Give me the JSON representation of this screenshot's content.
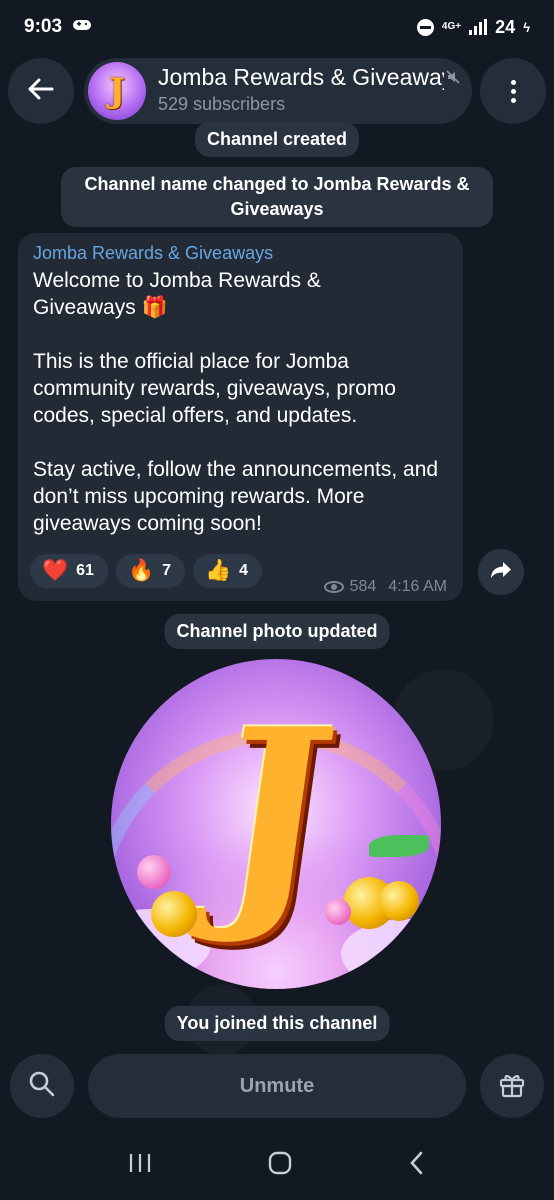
{
  "status": {
    "time": "9:03",
    "network": "4G+",
    "battery": "24"
  },
  "header": {
    "channel_title": "Jomba Rewards & Giveaways",
    "subscribers": "529 subscribers",
    "avatar_letter": "J"
  },
  "service_messages": {
    "created": "Channel created",
    "renamed": "Channel name changed to Jomba Rewards & Giveaways",
    "photo_updated": "Channel photo updated",
    "joined": "You joined this channel"
  },
  "post": {
    "author": "Jomba Rewards & Giveaways",
    "text": "Welcome to Jomba Rewards &\nGiveaways 🎁\n\nThis is the official place for Jomba community rewards, giveaways, promo codes, special offers, and updates.\n\nStay active, follow the announcements, and don’t miss upcoming rewards. More giveaways coming soon!",
    "reactions": [
      {
        "emoji": "❤️",
        "count": "61"
      },
      {
        "emoji": "🔥",
        "count": "7"
      },
      {
        "emoji": "👍",
        "count": "4"
      }
    ],
    "views": "584",
    "time": "4:16 AM"
  },
  "channel_photo": {
    "letter": "J"
  },
  "bottom": {
    "unmute_label": "Unmute"
  },
  "icons": {
    "back": "back-arrow-icon",
    "menu": "more-vertical-icon",
    "share": "share-icon",
    "search": "search-icon",
    "gift": "gift-icon",
    "muted": "muted-icon"
  }
}
